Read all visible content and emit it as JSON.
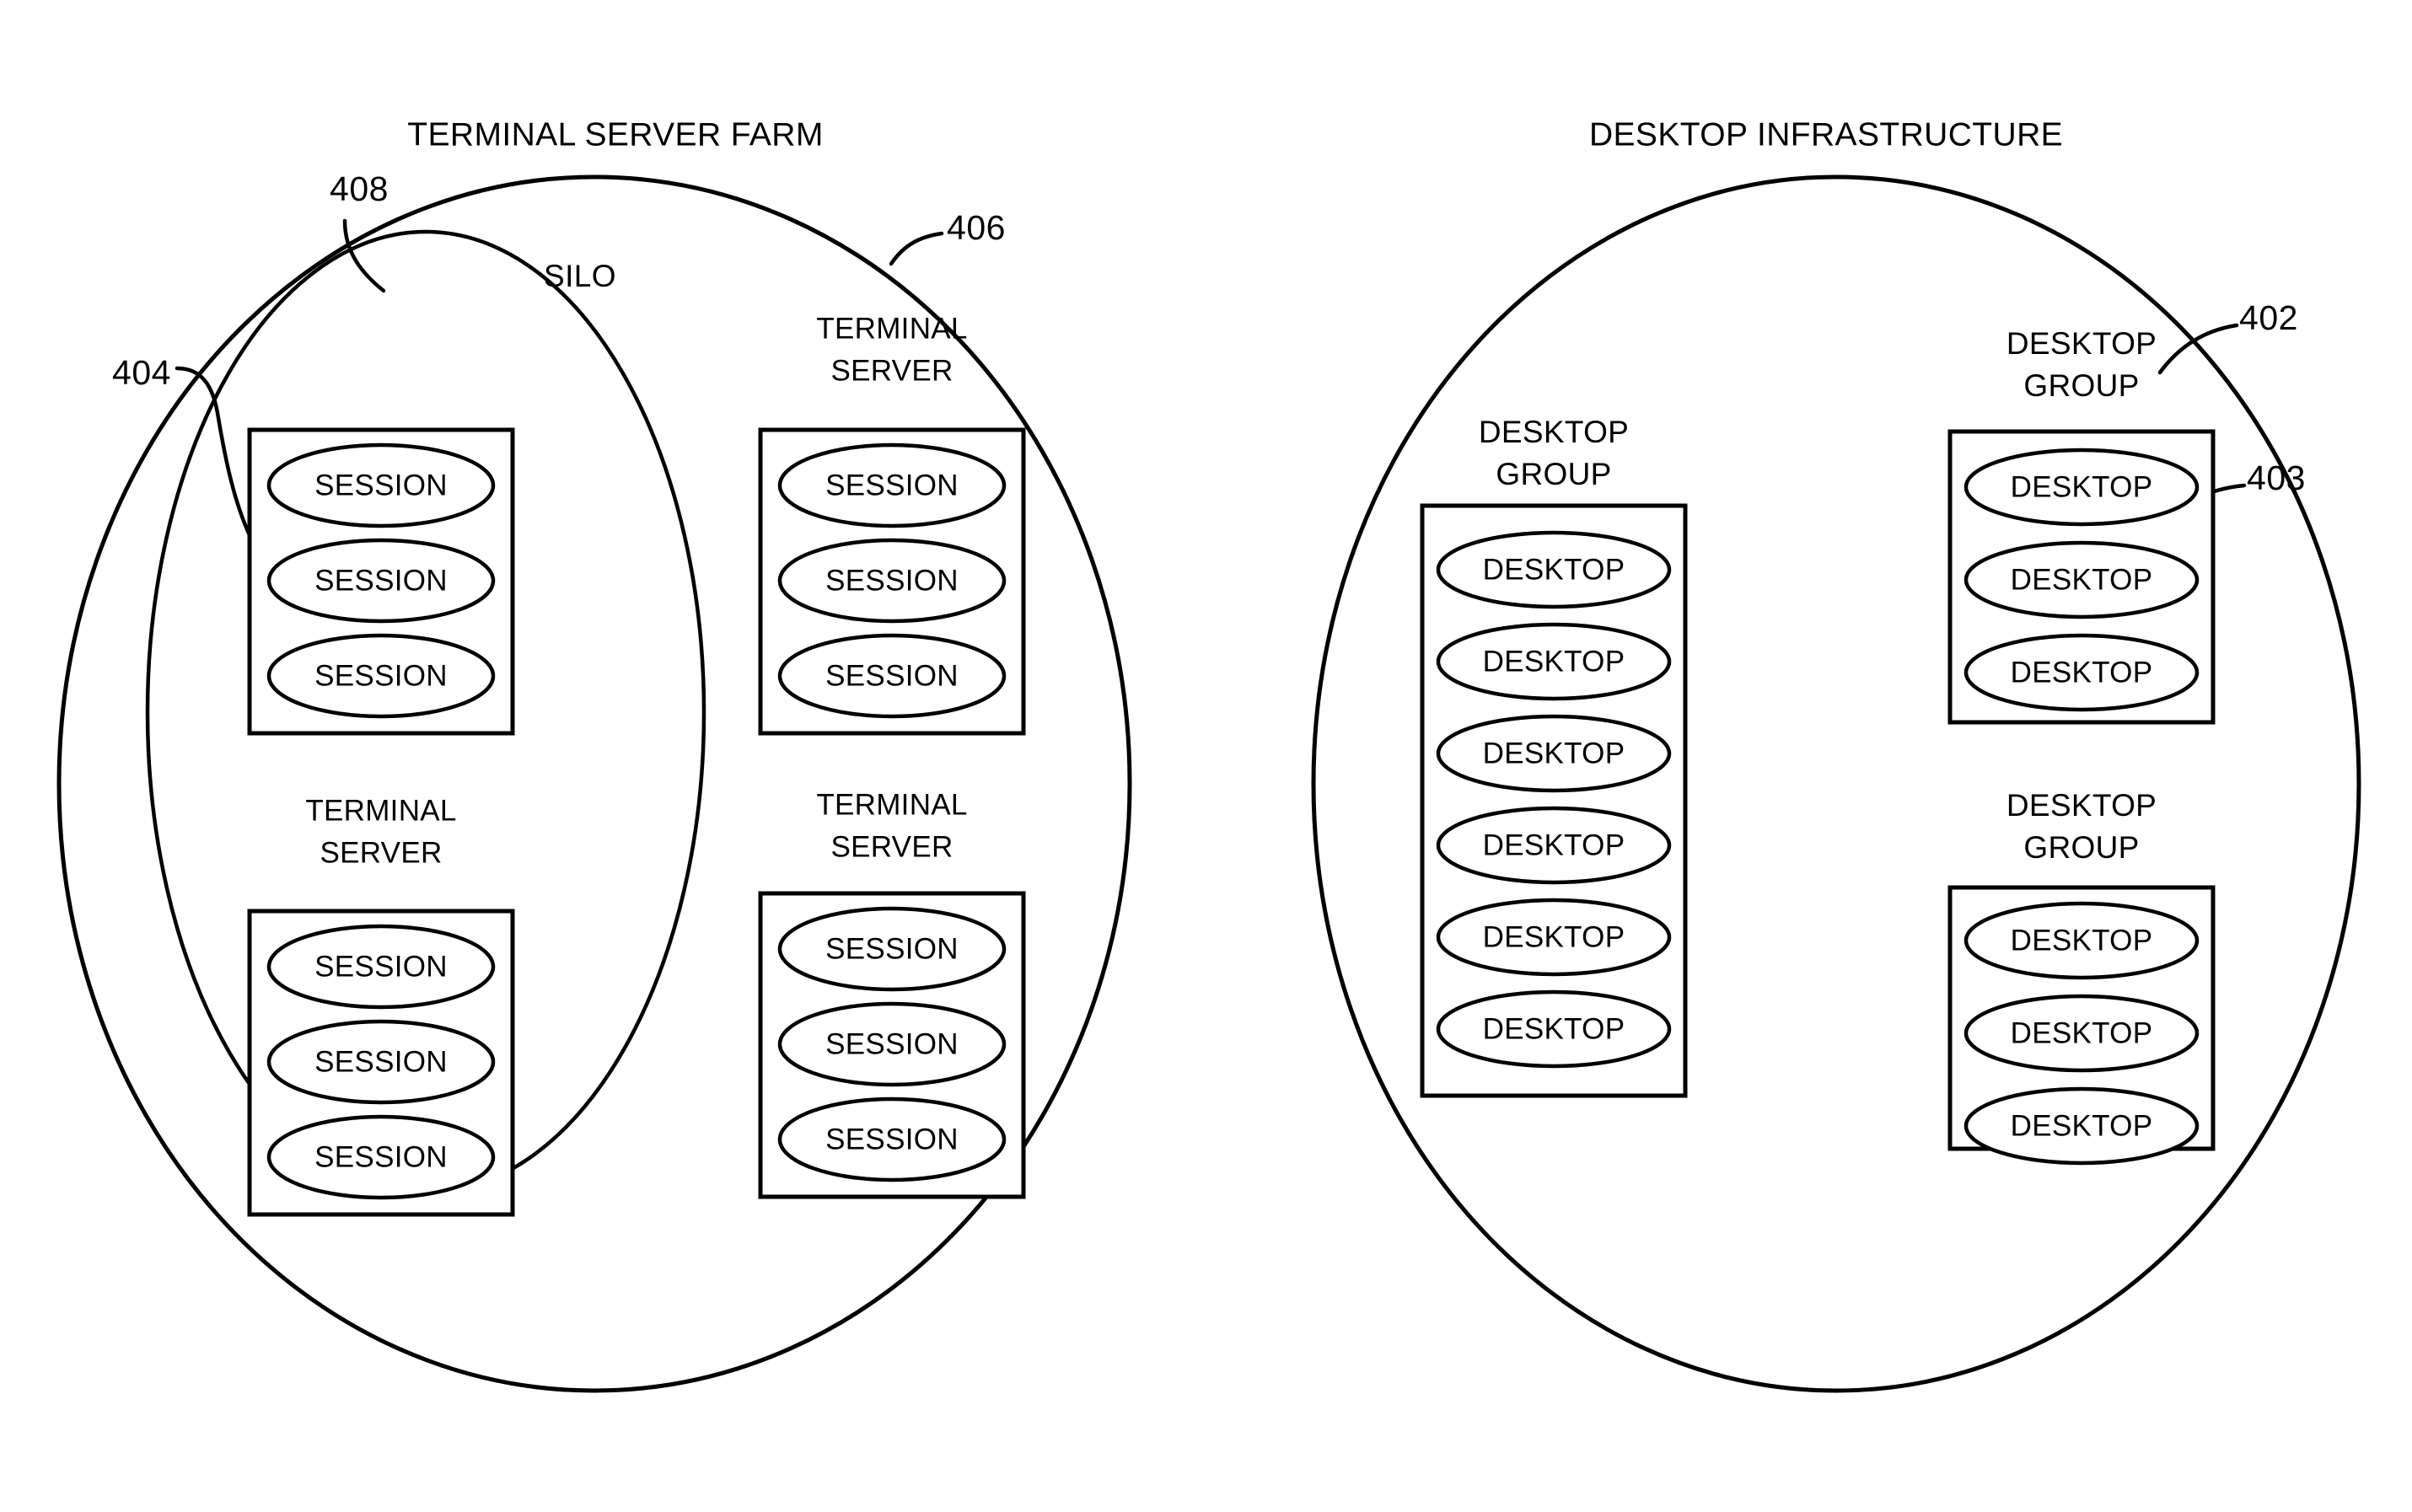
{
  "figure": {
    "type": "patent-diagram",
    "background_color": "#ffffff",
    "line_color": "#000000"
  },
  "titles": {
    "left": "TERMINAL SERVER FARM",
    "right": "DESKTOP INFRASTRUCTURE"
  },
  "reference_numerals": {
    "farm": "406",
    "silo": "408",
    "terminal_server": "404",
    "desktop_group": "402",
    "desktop": "403"
  },
  "left_container": {
    "name": "TERMINAL SERVER FARM",
    "inner_region_label": "SILO",
    "terminal_servers": [
      {
        "label_line1": "TERMINAL",
        "label_line2": "SERVER",
        "sessions": [
          "SESSION",
          "SESSION",
          "SESSION"
        ]
      },
      {
        "label_line1": "TERMINAL",
        "label_line2": "SERVER",
        "sessions": [
          "SESSION",
          "SESSION",
          "SESSION"
        ]
      },
      {
        "label_line1": "TERMINAL",
        "label_line2": "SERVER",
        "sessions": [
          "SESSION",
          "SESSION",
          "SESSION"
        ]
      },
      {
        "label_line1": "TERMINAL",
        "label_line2": "SERVER",
        "sessions": [
          "SESSION",
          "SESSION",
          "SESSION"
        ]
      }
    ]
  },
  "right_container": {
    "name": "DESKTOP INFRASTRUCTURE",
    "desktop_groups": [
      {
        "label_line1": "DESKTOP",
        "label_line2": "GROUP",
        "desktops": [
          "DESKTOP",
          "DESKTOP",
          "DESKTOP",
          "DESKTOP",
          "DESKTOP",
          "DESKTOP"
        ]
      },
      {
        "label_line1": "DESKTOP",
        "label_line2": "GROUP",
        "desktops": [
          "DESKTOP",
          "DESKTOP",
          "DESKTOP"
        ]
      },
      {
        "label_line1": "DESKTOP",
        "label_line2": "GROUP",
        "desktops": [
          "DESKTOP",
          "DESKTOP",
          "DESKTOP"
        ]
      }
    ]
  }
}
